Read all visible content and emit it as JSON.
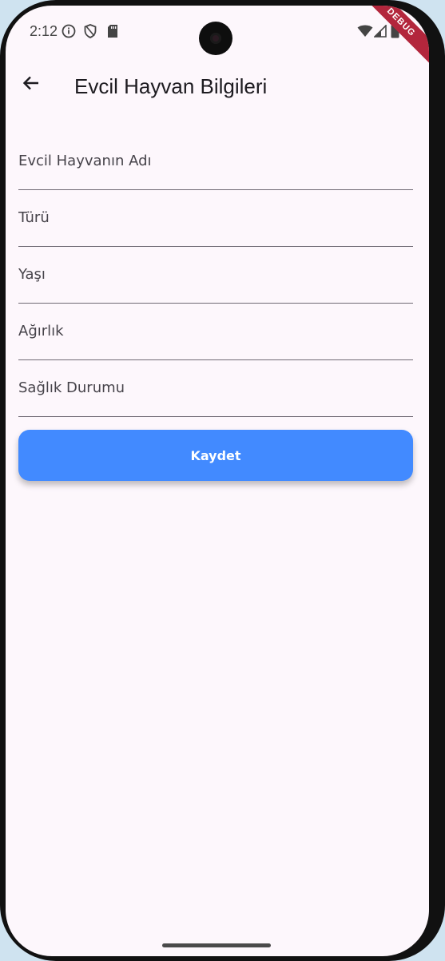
{
  "status_bar": {
    "time": "2:12",
    "icons": [
      "info-icon",
      "shield-icon",
      "sd-card-icon",
      "wifi-icon",
      "signal-icon",
      "battery-icon"
    ]
  },
  "debug_banner": "DEBUG",
  "app_bar": {
    "title": "Evcil Hayvan Bilgileri",
    "back_icon": "arrow-back-icon"
  },
  "form": {
    "fields": [
      {
        "placeholder": "Evcil Hayvanın Adı",
        "value": ""
      },
      {
        "placeholder": "Türü",
        "value": ""
      },
      {
        "placeholder": "Yaşı",
        "value": ""
      },
      {
        "placeholder": "Ağırlık",
        "value": ""
      },
      {
        "placeholder": "Sağlık Durumu",
        "value": ""
      }
    ],
    "save_label": "Kaydet"
  },
  "colors": {
    "background": "#fdf7fc",
    "button": "#428aff",
    "button_text": "#ffffff",
    "debug_banner": "#b3263c"
  }
}
